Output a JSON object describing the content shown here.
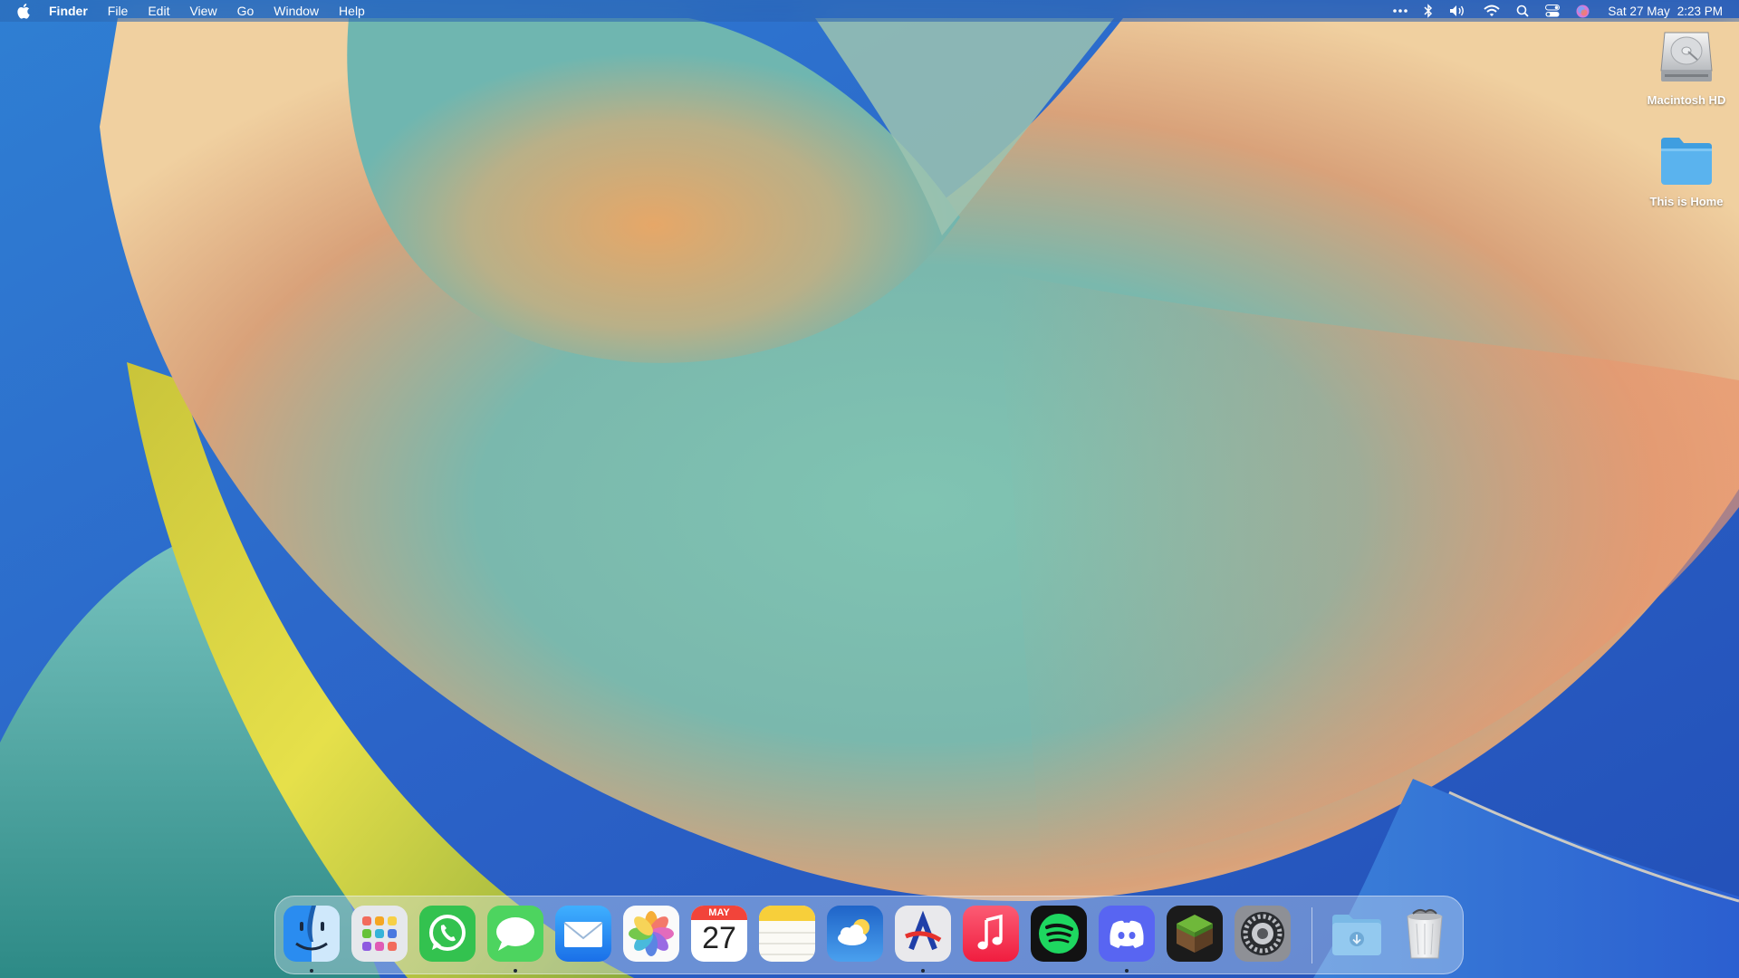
{
  "menubar": {
    "app_name": "Finder",
    "menus": [
      "File",
      "Edit",
      "View",
      "Go",
      "Window",
      "Help"
    ],
    "status_icons": [
      "more-icon",
      "bluetooth-icon",
      "volume-icon",
      "wifi-icon",
      "spotlight-search-icon",
      "control-center-icon",
      "siri-icon"
    ],
    "clock": {
      "date": "Sat 27 May",
      "time": "2:23 PM"
    }
  },
  "desktop": {
    "icons": [
      {
        "label": "Macintosh HD",
        "icon": "hard-drive-icon"
      },
      {
        "label": "This is Home",
        "icon": "folder-icon"
      }
    ]
  },
  "dock": {
    "apps": [
      {
        "name": "Finder",
        "icon": "finder-icon",
        "running": true
      },
      {
        "name": "Launchpad",
        "icon": "launchpad-icon",
        "running": false
      },
      {
        "name": "WhatsApp",
        "icon": "whatsapp-icon",
        "running": false
      },
      {
        "name": "Messages",
        "icon": "messages-icon",
        "running": true
      },
      {
        "name": "Mail",
        "icon": "mail-icon",
        "running": false
      },
      {
        "name": "Photos",
        "icon": "photos-icon",
        "running": false
      },
      {
        "name": "Calendar",
        "icon": "calendar-icon",
        "running": false
      },
      {
        "name": "Notes",
        "icon": "notes-icon",
        "running": false
      },
      {
        "name": "Weather",
        "icon": "weather-icon",
        "running": false
      },
      {
        "name": "Creative app",
        "icon": "creative-app-icon",
        "running": true
      },
      {
        "name": "Music",
        "icon": "music-icon",
        "running": false
      },
      {
        "name": "Spotify",
        "icon": "spotify-icon",
        "running": false
      },
      {
        "name": "Discord",
        "icon": "discord-icon",
        "running": true
      },
      {
        "name": "Minecraft",
        "icon": "minecraft-icon",
        "running": false
      },
      {
        "name": "System Settings",
        "icon": "system-settings-icon",
        "running": false
      }
    ],
    "calendar": {
      "month": "MAY",
      "day": "27"
    },
    "stacks": [
      {
        "name": "Downloads",
        "icon": "downloads-folder-icon"
      },
      {
        "name": "Trash",
        "icon": "trash-icon"
      }
    ]
  },
  "colors": {
    "wallpaper_blue": "#2a6fd0",
    "wallpaper_teal": "#7cc1b0",
    "wallpaper_orange": "#e0a070",
    "wallpaper_yellow": "#e8d83a",
    "folder_blue": "#5ab3ee"
  }
}
